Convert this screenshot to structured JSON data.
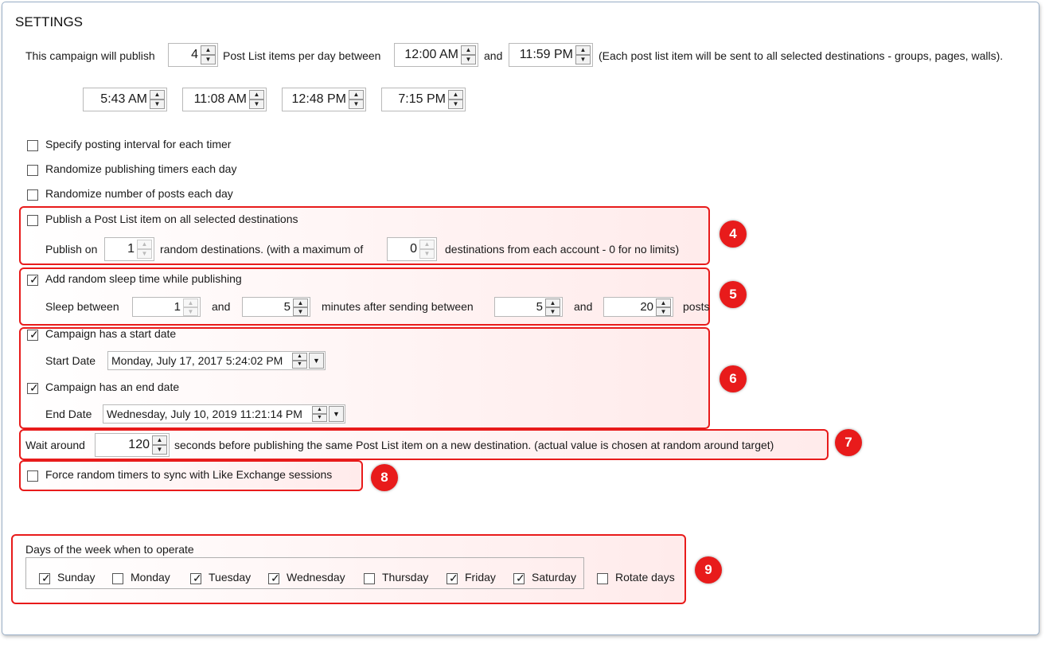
{
  "title": "SETTINGS",
  "publish_line": {
    "prefix": "This campaign will publish",
    "count": "4",
    "mid": "Post List items per day between",
    "start_time": "12:00 AM",
    "and": "and",
    "end_time": "11:59 PM",
    "suffix": "(Each post list item will be sent to all selected destinations - groups, pages, walls)."
  },
  "timers": [
    "5:43 AM",
    "11:08 AM",
    "12:48 PM",
    "7:15 PM"
  ],
  "options": {
    "specify_interval": "Specify posting interval for each timer",
    "randomize_timers": "Randomize publishing timers each day",
    "randomize_posts": "Randomize number of posts each day",
    "publish_all_dest": "Publish a Post List item on all selected destinations"
  },
  "publish_on": {
    "prefix": "Publish on",
    "count": "1",
    "mid": "random destinations. (with a maximum of",
    "max": "0",
    "suffix": "destinations from each account - 0 for no limits)"
  },
  "sleep": {
    "checkbox": "Add random sleep time while publishing",
    "prefix": "Sleep between",
    "min": "1",
    "and1": "and",
    "max": "5",
    "mid": "minutes after sending between",
    "posts_min": "5",
    "and2": "and",
    "posts_max": "20",
    "suffix": "posts"
  },
  "dates": {
    "start_checkbox": "Campaign has a start date",
    "start_label": "Start Date",
    "start_value": "Monday, July 17, 2017 5:24:02 PM",
    "end_checkbox": "Campaign has an end date",
    "end_label": "End Date",
    "end_value": "Wednesday, July 10, 2019 11:21:14 PM"
  },
  "wait": {
    "prefix": "Wait around",
    "value": "120",
    "suffix": "seconds before publishing the same Post List item on a new destination. (actual value is chosen at random around target)"
  },
  "force_sync": "Force random timers to sync with Like Exchange sessions",
  "days": {
    "label": "Days of the week when to operate",
    "items": [
      {
        "name": "Sunday",
        "checked": true
      },
      {
        "name": "Monday",
        "checked": false
      },
      {
        "name": "Tuesday",
        "checked": true
      },
      {
        "name": "Wednesday",
        "checked": true
      },
      {
        "name": "Thursday",
        "checked": false
      },
      {
        "name": "Friday",
        "checked": true
      },
      {
        "name": "Saturday",
        "checked": true
      }
    ],
    "rotate": "Rotate days"
  },
  "markers": [
    "4",
    "5",
    "6",
    "7",
    "8",
    "9"
  ],
  "colors": {
    "highlight": "#e81b1b",
    "border": "#9bb0c8"
  }
}
